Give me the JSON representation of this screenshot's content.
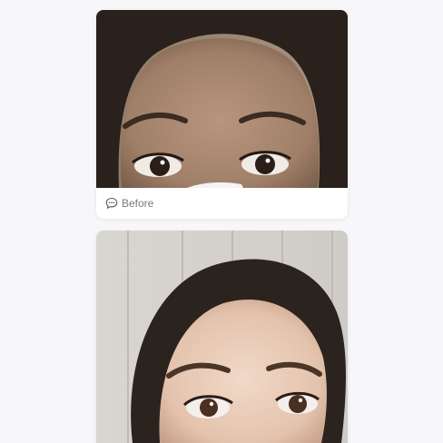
{
  "posts": [
    {
      "caption": "Before",
      "caption_icon": "speech-bubble-icon"
    },
    {
      "caption": "",
      "caption_icon": ""
    }
  ],
  "colors": {
    "background": "#f7f7f9",
    "card": "#ffffff",
    "caption_text": "#7b7b7b"
  }
}
